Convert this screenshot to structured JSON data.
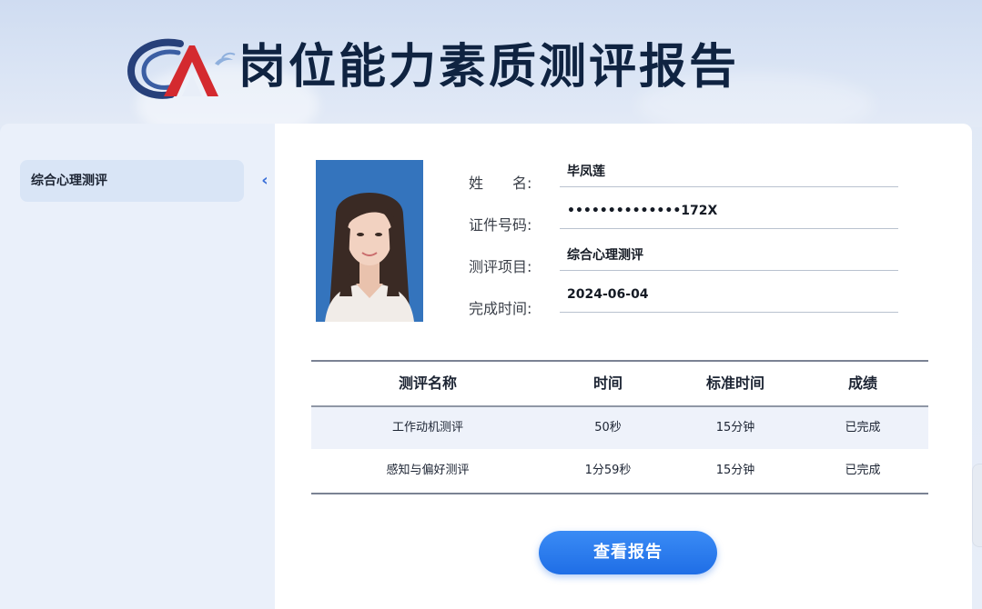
{
  "header": {
    "title": "岗位能力素质测评报告",
    "logo": "CA-logo"
  },
  "sidebar": {
    "items": [
      {
        "label": "综合心理测评",
        "active": true
      }
    ],
    "collapse_icon": "chevron-left-icon"
  },
  "profile": {
    "photo": "portrait-photo",
    "fields": [
      {
        "label": "姓　　名:",
        "value": "毕凤莲"
      },
      {
        "label": "证件号码:",
        "value": "••••••••••••••172X"
      },
      {
        "label": "测评项目:",
        "value": "综合心理测评"
      },
      {
        "label": "完成时间:",
        "value": "2024-06-04"
      }
    ]
  },
  "table": {
    "headers": [
      "测评名称",
      "时间",
      "标准时间",
      "成绩"
    ],
    "rows": [
      [
        "工作动机测评",
        "50秒",
        "15分钟",
        "已完成"
      ],
      [
        "感知与偏好测评",
        "1分59秒",
        "15分钟",
        "已完成"
      ]
    ]
  },
  "actions": {
    "view_report_label": "查看报告"
  },
  "colors": {
    "accent": "#2a7cef",
    "header_bg": "#d5e1f3",
    "title": "#0f2341"
  }
}
